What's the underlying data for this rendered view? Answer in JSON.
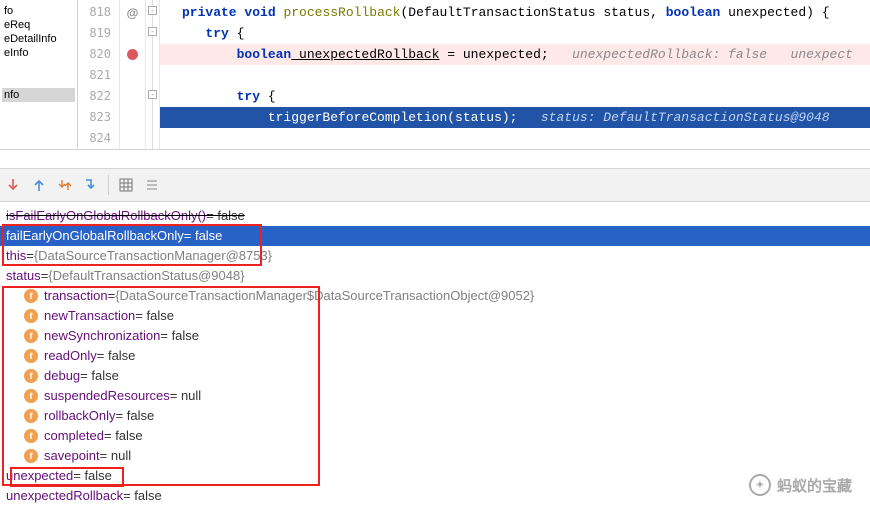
{
  "leftTree": {
    "items": [
      "fo",
      "eReq",
      "eDetailInfo",
      "eInfo",
      "nfo"
    ]
  },
  "gutter": [
    "818",
    "819",
    "820",
    "821",
    "822",
    "823",
    "824"
  ],
  "markerAt": "@",
  "code": {
    "l818": {
      "kw1": "private",
      "kw2": "void",
      "method": "processRollback",
      "sig": "(DefaultTransactionStatus status, ",
      "kw3": "boolean",
      "sig2": " unexpected) {"
    },
    "l819": {
      "indent": "   ",
      "kw": "try",
      "brace": " {"
    },
    "l820": {
      "indent": "       ",
      "kw": "boolean",
      "var": " unexpectedRollback",
      "rest": " = unexpected;   ",
      "comment": "unexpectedRollback: false   unexpect"
    },
    "l821": "",
    "l822": {
      "indent": "       ",
      "kw": "try",
      "brace": " {"
    },
    "l823": {
      "indent": "           ",
      "call": "triggerBeforeCompletion(status);   ",
      "comment": "status: DefaultTransactionStatus@9048"
    }
  },
  "vars": {
    "r1": {
      "name": "isFailEarlyOnGlobalRollbackOnly()",
      "val": "= false"
    },
    "r2": {
      "name": "failEarlyOnGlobalRollbackOnly",
      "val": " = false"
    },
    "r3": {
      "name": "this",
      "eq": " = ",
      "val": "{DataSourceTransactionManager@8753}"
    },
    "r4": {
      "name": "status",
      "eq": " = ",
      "val": "{DefaultTransactionStatus@9048}"
    },
    "r5": {
      "name": "transaction",
      "eq": " = ",
      "val": "{DataSourceTransactionManager$DataSourceTransactionObject@9052}"
    },
    "r6": {
      "name": "newTransaction",
      "val": " = false"
    },
    "r7": {
      "name": "newSynchronization",
      "val": " = false"
    },
    "r8": {
      "name": "readOnly",
      "val": " = false"
    },
    "r9": {
      "name": "debug",
      "val": " = false"
    },
    "r10": {
      "name": "suspendedResources",
      "val": " = null"
    },
    "r11": {
      "name": "rollbackOnly",
      "val": " = false"
    },
    "r12": {
      "name": "completed",
      "val": " = false"
    },
    "r13": {
      "name": "savepoint",
      "val": " = null"
    },
    "r14": {
      "name": "unexpected",
      "val": " = false"
    },
    "r15": {
      "name": "unexpectedRollback",
      "val": " = false"
    }
  },
  "watermark": "蚂蚁的宝藏"
}
